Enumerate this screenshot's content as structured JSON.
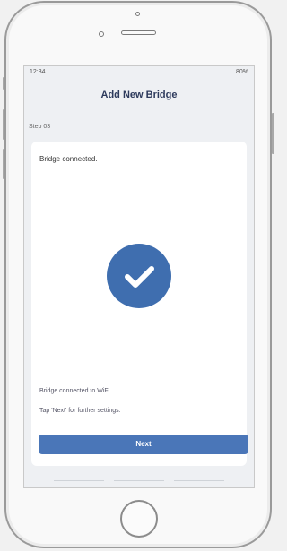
{
  "status_bar": {
    "time": "12:34",
    "indicators": "80%"
  },
  "header": {
    "title": "Add New Bridge"
  },
  "step_label": "Step 03",
  "card": {
    "status_title": "Bridge connected.",
    "success_icon": "check-circle-icon",
    "message_wifi": "Bridge connected to WiFi.",
    "message_hint": "Tap 'Next' for further settings."
  },
  "actions": {
    "next_label": "Next"
  },
  "colors": {
    "accent": "#4a76b8",
    "check_circle": "#3f6eaf",
    "title_text": "#2d3a5c",
    "screen_background": "#eef0f3",
    "card_background": "#ffffff"
  }
}
